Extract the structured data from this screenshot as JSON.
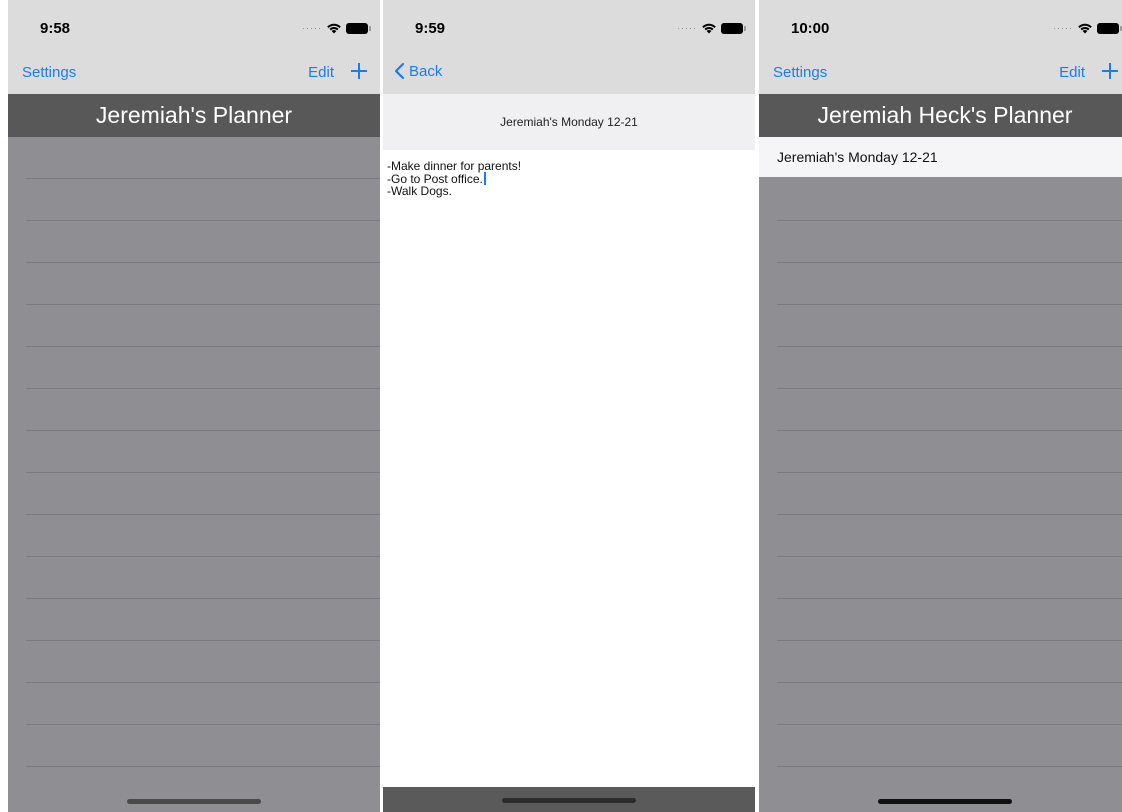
{
  "screens": [
    {
      "status": {
        "time": "9:58"
      },
      "nav": {
        "settings": "Settings",
        "edit": "Edit"
      },
      "title": "Jeremiah's Planner"
    },
    {
      "status": {
        "time": "9:59"
      },
      "nav": {
        "back": "Back"
      },
      "note_title": "Jeremiah's Monday 12-21",
      "note_lines": [
        "-Make dinner for parents!",
        "-Go to Post office.",
        "-Walk Dogs."
      ]
    },
    {
      "status": {
        "time": "10:00"
      },
      "nav": {
        "settings": "Settings",
        "edit": "Edit"
      },
      "title": "Jeremiah Heck's Planner",
      "rows": [
        "Jeremiah's Monday 12-21"
      ]
    }
  ],
  "colors": {
    "accent": "#1a7cf5",
    "nav_background": "#dcdcdc",
    "title_bar": "#585858",
    "list_background": "#8e8e93"
  },
  "icons": [
    "wifi-icon",
    "battery-icon",
    "plus-icon",
    "chevron-left-icon"
  ]
}
